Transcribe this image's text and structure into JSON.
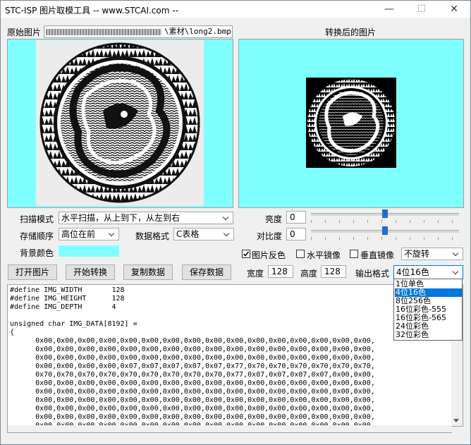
{
  "window": {
    "title": "STC-ISP 图片取模工具 -- www.STCAI.com --",
    "minimize": "—",
    "maximize": "☐",
    "close": "✕"
  },
  "source": {
    "label": "原始图片",
    "path": "\\素材\\long2.bmp"
  },
  "result": {
    "label": "转换后的图片"
  },
  "settings": {
    "scan_mode_label": "扫描模式",
    "scan_mode_value": "水平扫描，从上到下，从左到右",
    "storage_label": "存储顺序",
    "storage_value": "高位在前",
    "data_format_label": "数据格式",
    "data_format_value": "C表格",
    "bg_color_label": "背景颜色",
    "bg_color": "#80ffff",
    "brightness_label": "亮度",
    "brightness_value": "0",
    "contrast_label": "对比度",
    "contrast_value": "0",
    "invert_label": "图片反色",
    "invert_checked": true,
    "hmirror_label": "水平镜像",
    "vmirror_label": "垂直镜像",
    "rotate_value": "不旋转",
    "width_label": "宽度",
    "width_value": "128",
    "height_label": "高度",
    "height_value": "128",
    "output_format_label": "输出格式",
    "output_format_value": "4位16色",
    "output_format_options": [
      "1位单色",
      "4位16色",
      "8位256色",
      "16位彩色-555",
      "16位彩色-565",
      "24位彩色",
      "32位彩色"
    ]
  },
  "buttons": {
    "open": "打开图片",
    "convert": "开始转换",
    "copy": "复制数据",
    "save": "保存数据"
  },
  "code_text": "#define IMG_WIDTH       128\n#define IMG_HEIGHT      128\n#define IMG_DEPTH       4\n\nunsigned char IMG_DATA[8192] =\n{\n      0x00,0x00,0x00,0x00,0x00,0x00,0x00,0x00,0x00,0x00,0x00,0x00,0x00,0x00,0x00,0x00,\n      0x00,0x00,0x00,0x00,0x00,0x00,0x00,0x00,0x00,0x00,0x00,0x00,0x00,0x00,0x00,0x00,\n      0x00,0x00,0x00,0x00,0x00,0x00,0x00,0x00,0x00,0x00,0x00,0x00,0x00,0x00,0x00,0x00,\n      0x00,0x00,0x00,0x00,0x07,0x07,0x07,0x07,0x07,0x77,0x70,0x70,0x70,0x70,0x70,0x70,\n      0x70,0x70,0x70,0x70,0x70,0x70,0x70,0x70,0x70,0x77,0x07,0x07,0x07,0x07,0x00,0x00,\n      0x00,0x00,0x00,0x00,0x00,0x00,0x00,0x00,0x00,0x00,0x00,0x00,0x00,0x00,0x00,0x00,\n      0x00,0x00,0x00,0x00,0x00,0x00,0x00,0x00,0x00,0x00,0x00,0x00,0x00,0x00,0x00,0x00,\n      0x00,0x00,0x00,0x00,0x00,0x00,0x00,0x00,0x00,0x00,0x00,0x00,0x00,0x00,0x00,0x00,\n      0x00,0x00,0x00,0x00,0x00,0x00,0x00,0x00,0x00,0x00,0x00,0x00,0x00,0x00,0x00,0x00,\n      0x00,0x00,0x00,0x00,0x00,0x00,0x00,0x00,0x00,0x00,0x00,0x00,0x00,0x00,0x00,0x00,\n      0x00,0x00,0x00,0x00,0x00,0x00,0x00,0x00,0x00,0x00,0x00,0x00,0x00,0x00,0x00,0x00,\n      0x00,0x00,0x00,0x00,0x00,0x00,0x00,0x00,0x00,0x00,0x00,0x00,0x00,0x00,0x00,0x00"
}
